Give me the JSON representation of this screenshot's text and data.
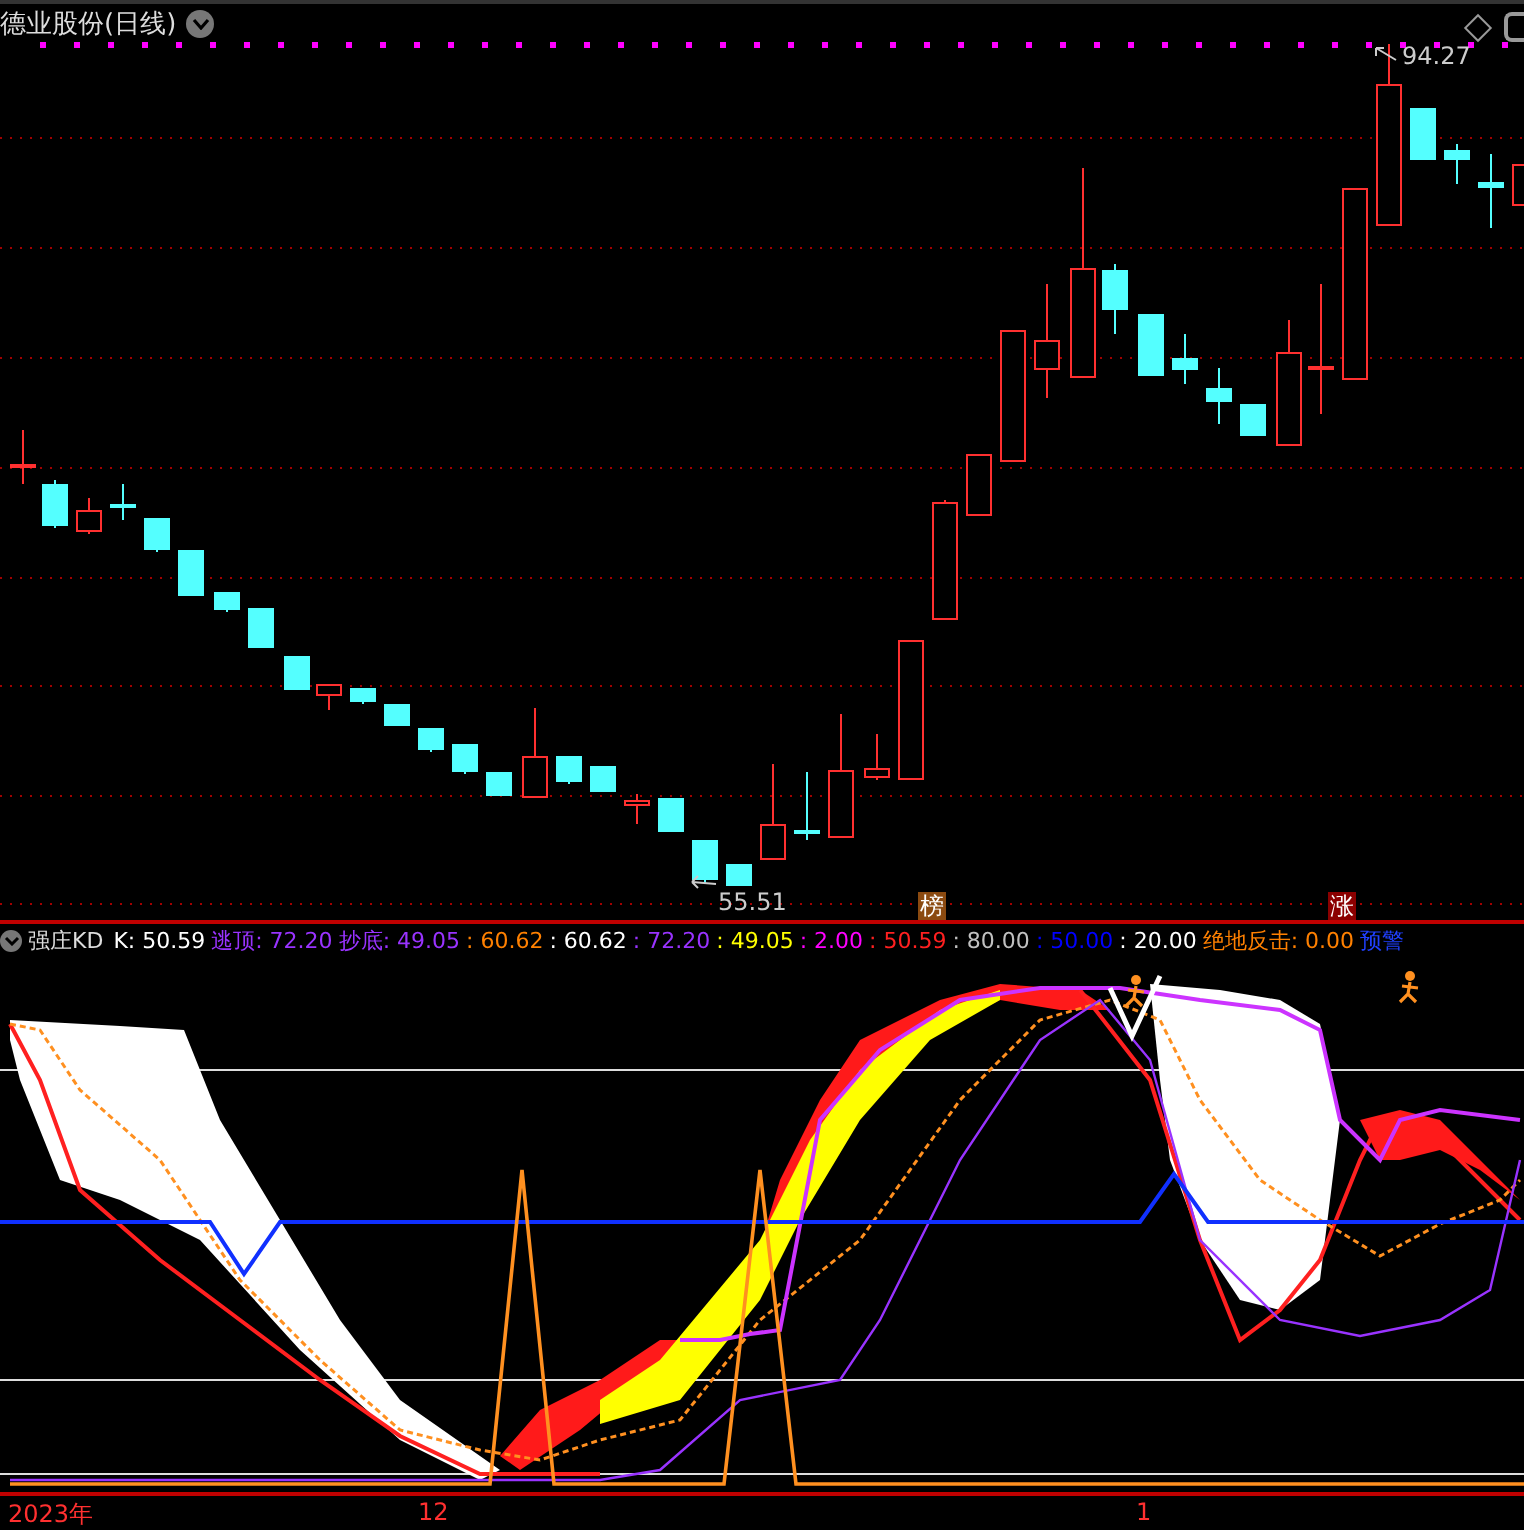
{
  "title": "德业股份(日线)",
  "price_high": "94.27",
  "price_low": "55.51",
  "signal_badges": [
    {
      "text": "榜",
      "color": "#8b4a10"
    },
    {
      "text": "涨",
      "color": "#8b0000"
    }
  ],
  "indicator": {
    "name": "强庄KD",
    "values": [
      {
        "text": "K: 50.59",
        "color": "#ffffff"
      },
      {
        "text": "逃顶: 72.20",
        "color": "#9933ff"
      },
      {
        "text": "抄底: 49.05",
        "color": "#9933ff"
      },
      {
        "text": ": 60.62",
        "color": "#ff8000"
      },
      {
        "text": ": 60.62",
        "color": "#ffffff"
      },
      {
        "text": ": 72.20",
        "color": "#9933ff"
      },
      {
        "text": ": 49.05",
        "color": "#ffff00"
      },
      {
        "text": ": 2.00",
        "color": "#ff00ff"
      },
      {
        "text": ": 50.59",
        "color": "#ff2020"
      },
      {
        "text": ": 80.00",
        "color": "#c0c0c0"
      },
      {
        "text": ": 50.00",
        "color": "#0000ff"
      },
      {
        "text": ": 20.00",
        "color": "#ffffff"
      },
      {
        "text": "绝地反击: 0.00",
        "color": "#ff8000"
      },
      {
        "text": "预警",
        "color": "#2040ff"
      }
    ]
  },
  "axis_labels": [
    "2023年",
    "12",
    "1"
  ]
}
